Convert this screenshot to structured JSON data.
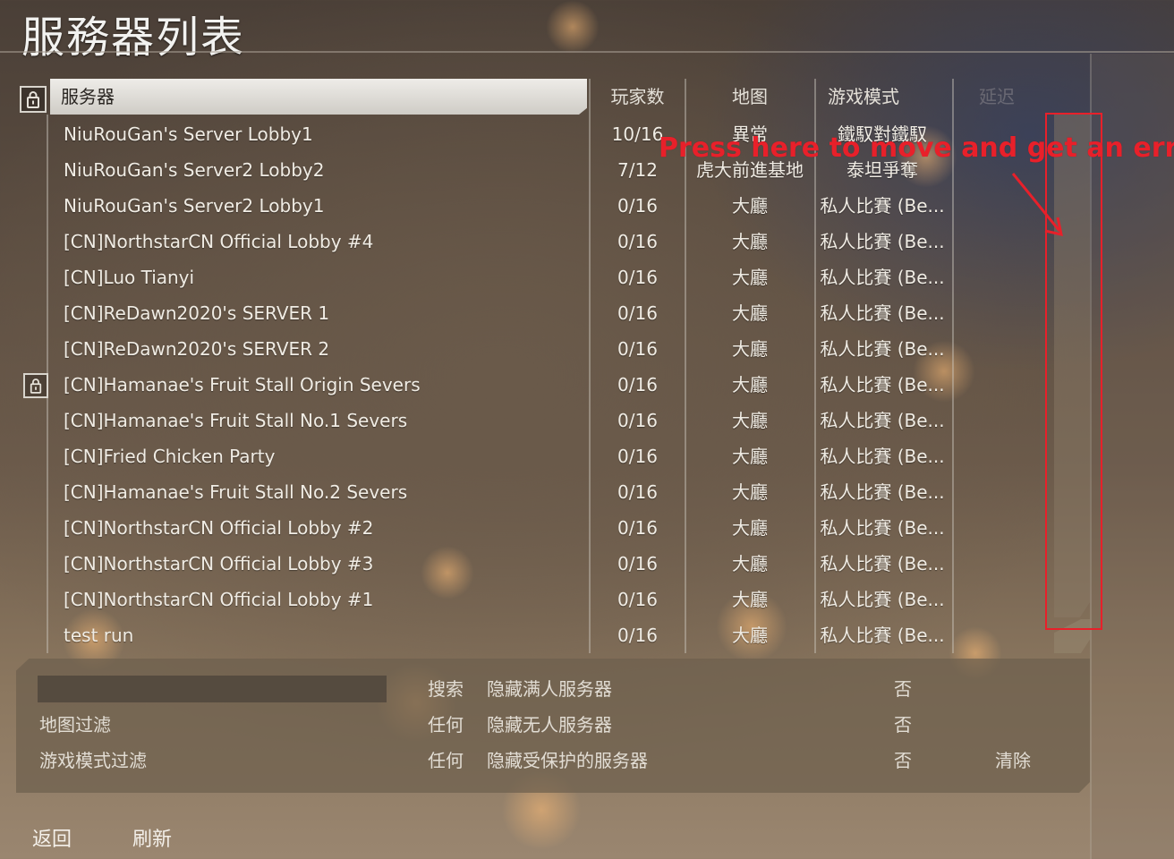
{
  "page": {
    "title": "服務器列表"
  },
  "table": {
    "headers": {
      "name": "服务器",
      "players": "玩家数",
      "map": "地图",
      "mode": "游戏模式",
      "ping": "延迟"
    },
    "rows": [
      {
        "name": "NiuRouGan's Server Lobby1",
        "players": "10/16",
        "map": "異常",
        "mode": "鐵馭對鐵馭",
        "locked": false
      },
      {
        "name": "NiuRouGan's Server2 Lobby2",
        "players": "7/12",
        "map": "虎大前進基地",
        "mode": "泰坦爭奪",
        "locked": false
      },
      {
        "name": "NiuRouGan's Server2 Lobby1",
        "players": "0/16",
        "map": "大廳",
        "mode": "私人比賽 (Be...",
        "locked": false
      },
      {
        "name": "[CN]NorthstarCN Official Lobby #4",
        "players": "0/16",
        "map": "大廳",
        "mode": "私人比賽 (Be...",
        "locked": false
      },
      {
        "name": "[CN]Luo Tianyi",
        "players": "0/16",
        "map": "大廳",
        "mode": "私人比賽 (Be...",
        "locked": false
      },
      {
        "name": "[CN]ReDawn2020's SERVER 1",
        "players": "0/16",
        "map": "大廳",
        "mode": "私人比賽 (Be...",
        "locked": false
      },
      {
        "name": "[CN]ReDawn2020's SERVER 2",
        "players": "0/16",
        "map": "大廳",
        "mode": "私人比賽 (Be...",
        "locked": false
      },
      {
        "name": "[CN]Hamanae's Fruit Stall Origin Severs",
        "players": "0/16",
        "map": "大廳",
        "mode": "私人比賽 (Be...",
        "locked": true
      },
      {
        "name": "[CN]Hamanae's Fruit Stall No.1 Severs",
        "players": "0/16",
        "map": "大廳",
        "mode": "私人比賽 (Be...",
        "locked": false
      },
      {
        "name": "[CN]Fried Chicken Party",
        "players": "0/16",
        "map": "大廳",
        "mode": "私人比賽 (Be...",
        "locked": false
      },
      {
        "name": "[CN]Hamanae's Fruit Stall No.2 Severs",
        "players": "0/16",
        "map": "大廳",
        "mode": "私人比賽 (Be...",
        "locked": false
      },
      {
        "name": "[CN]NorthstarCN Official Lobby #2",
        "players": "0/16",
        "map": "大廳",
        "mode": "私人比賽 (Be...",
        "locked": false
      },
      {
        "name": "[CN]NorthstarCN Official Lobby #3",
        "players": "0/16",
        "map": "大廳",
        "mode": "私人比賽 (Be...",
        "locked": false
      },
      {
        "name": "[CN]NorthstarCN Official Lobby #1",
        "players": "0/16",
        "map": "大廳",
        "mode": "私人比賽 (Be...",
        "locked": false
      },
      {
        "name": "test run",
        "players": "0/16",
        "map": "大廳",
        "mode": "私人比賽 (Be...",
        "locked": false
      }
    ]
  },
  "annotation": {
    "text": "Press here to move and get an error",
    "color": "#e8202a"
  },
  "filters": {
    "search_label": "搜索",
    "map_filter_label": "地图过滤",
    "map_filter_value": "任何",
    "mode_filter_label": "游戏模式过滤",
    "mode_filter_value": "任何",
    "hide_full_label": "隐藏满人服务器",
    "hide_full_value": "否",
    "hide_empty_label": "隐藏无人服务器",
    "hide_empty_value": "否",
    "hide_protected_label": "隐藏受保护的服务器",
    "hide_protected_value": "否",
    "clear_label": "清除"
  },
  "footer": {
    "back_label": "返回",
    "refresh_label": "刷新"
  },
  "icons": {
    "lock": "lock-icon",
    "arrow": "arrow-icon"
  }
}
